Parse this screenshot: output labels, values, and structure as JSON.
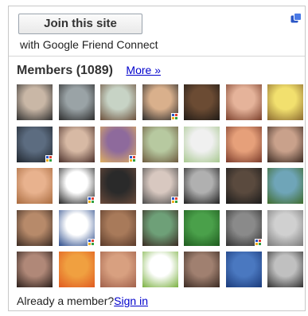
{
  "join": {
    "button_label": "Join this site",
    "subtitle": "with Google Friend Connect"
  },
  "members": {
    "title": "Members (1089)",
    "more_label": "More »"
  },
  "footer": {
    "prompt": "Already a member?",
    "sign_in_label": "Sign in"
  },
  "colors": {
    "link": "#0000cc",
    "border": "#c8c8c8",
    "gfc_blue": "#2a56c6"
  },
  "icons": {
    "top_right": "google-friend-connect-icon",
    "avatar_badge": "gfc-badge-icon"
  },
  "avatars": [
    {
      "a": "#c9b7a6",
      "b": "#2d2d2d",
      "badge": false
    },
    {
      "a": "#9aa3a6",
      "b": "#2b2b2b",
      "badge": false
    },
    {
      "a": "#c7d3c5",
      "b": "#6b4f3a",
      "badge": false
    },
    {
      "a": "#d9b08c",
      "b": "#2a2a2a",
      "badge": true
    },
    {
      "a": "#6b4b33",
      "b": "#1f1a16",
      "badge": false
    },
    {
      "a": "#e5b39a",
      "b": "#7a3e2a",
      "badge": false
    },
    {
      "a": "#f2e06e",
      "b": "#8b6a2f",
      "badge": false
    },
    {
      "a": "#5c6c80",
      "b": "#1e242c",
      "badge": true
    },
    {
      "a": "#d7b9a4",
      "b": "#4a2f2a",
      "badge": false
    },
    {
      "a": "#8e6a9c",
      "b": "#e0b060",
      "badge": true
    },
    {
      "a": "#b7c9a0",
      "b": "#6d5a3e",
      "badge": false
    },
    {
      "a": "#f0f0f0",
      "b": "#a8c890",
      "badge": false
    },
    {
      "a": "#e6a07a",
      "b": "#7a3a2a",
      "badge": false
    },
    {
      "a": "#c9a18b",
      "b": "#3b2a22",
      "badge": false
    },
    {
      "a": "#e8b28e",
      "b": "#a86a3e",
      "badge": false
    },
    {
      "a": "#ffffff",
      "b": "#222222",
      "badge": true
    },
    {
      "a": "#2a2a2a",
      "b": "#6a4a3a",
      "badge": false
    },
    {
      "a": "#d8c8c0",
      "b": "#4a4a4a",
      "badge": true
    },
    {
      "a": "#b0b0b0",
      "b": "#202020",
      "badge": false
    },
    {
      "a": "#5a4a3e",
      "b": "#1a1a1a",
      "badge": false
    },
    {
      "a": "#6fa5b8",
      "b": "#3e6a2a",
      "badge": false
    },
    {
      "a": "#b78a6a",
      "b": "#3a2a22",
      "badge": false
    },
    {
      "a": "#ffffff",
      "b": "#2a4a8a",
      "badge": true
    },
    {
      "a": "#a87a5a",
      "b": "#5a3a2a",
      "badge": false
    },
    {
      "a": "#6ea078",
      "b": "#3a2a22",
      "badge": false
    },
    {
      "a": "#4aa04a",
      "b": "#1e5a1e",
      "badge": false
    },
    {
      "a": "#8a8a8a",
      "b": "#303030",
      "badge": true
    },
    {
      "a": "#d0d0d0",
      "b": "#7a7a7a",
      "badge": false
    },
    {
      "a": "#b08878",
      "b": "#2a1e1a",
      "badge": false
    },
    {
      "a": "#f0a040",
      "b": "#e05a20",
      "badge": false
    },
    {
      "a": "#d8a080",
      "b": "#a0604a",
      "badge": false
    },
    {
      "a": "#ffffff",
      "b": "#7ab040",
      "badge": false
    },
    {
      "a": "#a08070",
      "b": "#3a2a22",
      "badge": false
    },
    {
      "a": "#4a78c0",
      "b": "#1a3a7a",
      "badge": false
    },
    {
      "a": "#c0c0c0",
      "b": "#303030",
      "badge": false
    }
  ]
}
